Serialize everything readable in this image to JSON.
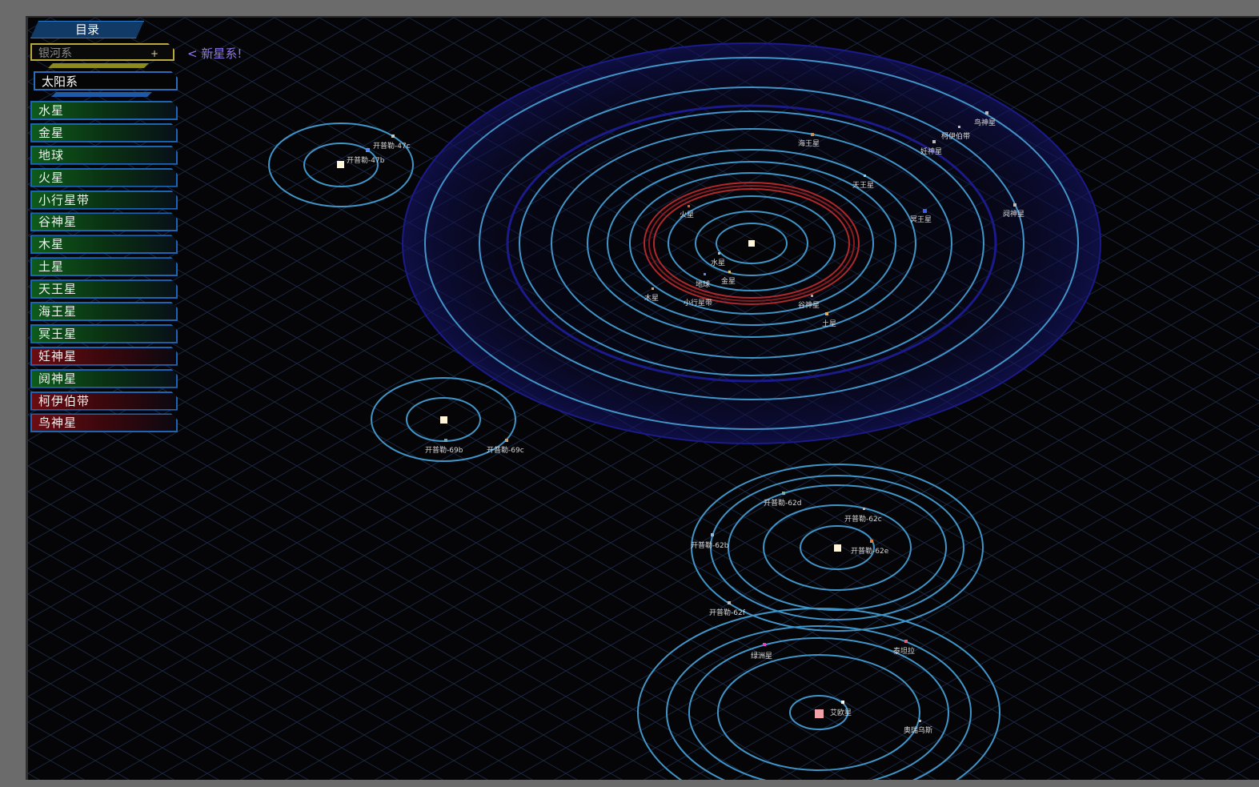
{
  "menu": {
    "header": "目录",
    "galaxy_field": "银河系",
    "galaxy_plus": "+",
    "new_system": "< 新星系!",
    "selected_system": "太阳系",
    "planets": [
      {
        "label": "水星",
        "color": "green"
      },
      {
        "label": "金星",
        "color": "green"
      },
      {
        "label": "地球",
        "color": "green"
      },
      {
        "label": "火星",
        "color": "green"
      },
      {
        "label": "小行星带",
        "color": "green"
      },
      {
        "label": "谷神星",
        "color": "green"
      },
      {
        "label": "木星",
        "color": "green"
      },
      {
        "label": "土星",
        "color": "green"
      },
      {
        "label": "天王星",
        "color": "green"
      },
      {
        "label": "海王星",
        "color": "green"
      },
      {
        "label": "冥王星",
        "color": "green"
      },
      {
        "label": "妊神星",
        "color": "red"
      },
      {
        "label": "阋神星",
        "color": "green"
      },
      {
        "label": "柯伊伯带",
        "color": "red"
      },
      {
        "label": "鸟神星",
        "color": "red"
      }
    ]
  },
  "map": {
    "colors": {
      "orbit": "#3f95c8",
      "belt": "#b0282a",
      "halo": "#1a1a8a",
      "grid": "#1a2a48"
    },
    "labels": {
      "s1_a": "开普勒-47c",
      "s1_b": "开普勒-47b",
      "sol_mercury": "水星",
      "sol_venus": "金星",
      "sol_earth": "地球",
      "sol_mars": "火星",
      "sol_asteroid": "小行星带",
      "sol_ceres": "谷神星",
      "sol_jupiter": "木星",
      "sol_saturn": "土星",
      "sol_uranus": "天王星",
      "sol_neptune": "海王星",
      "sol_pluto": "冥王星",
      "sol_haumea": "妊神星",
      "sol_kuiper": "柯伊伯带",
      "sol_makemake": "鸟神星",
      "sol_eris": "阋神星",
      "s3_a": "开普勒-69b",
      "s3_b": "开普勒-69c",
      "s4_a": "开普勒-62d",
      "s4_b": "开普勒-62c",
      "s4_c": "开普勒-62b",
      "s4_d": "开普勒-62e",
      "s4_e": "开普勒-62f",
      "s5_a": "绿洲星",
      "s5_b": "泰坦拉",
      "s5_c": "艾欧星",
      "s5_d": "奥瑞乌斯"
    }
  }
}
